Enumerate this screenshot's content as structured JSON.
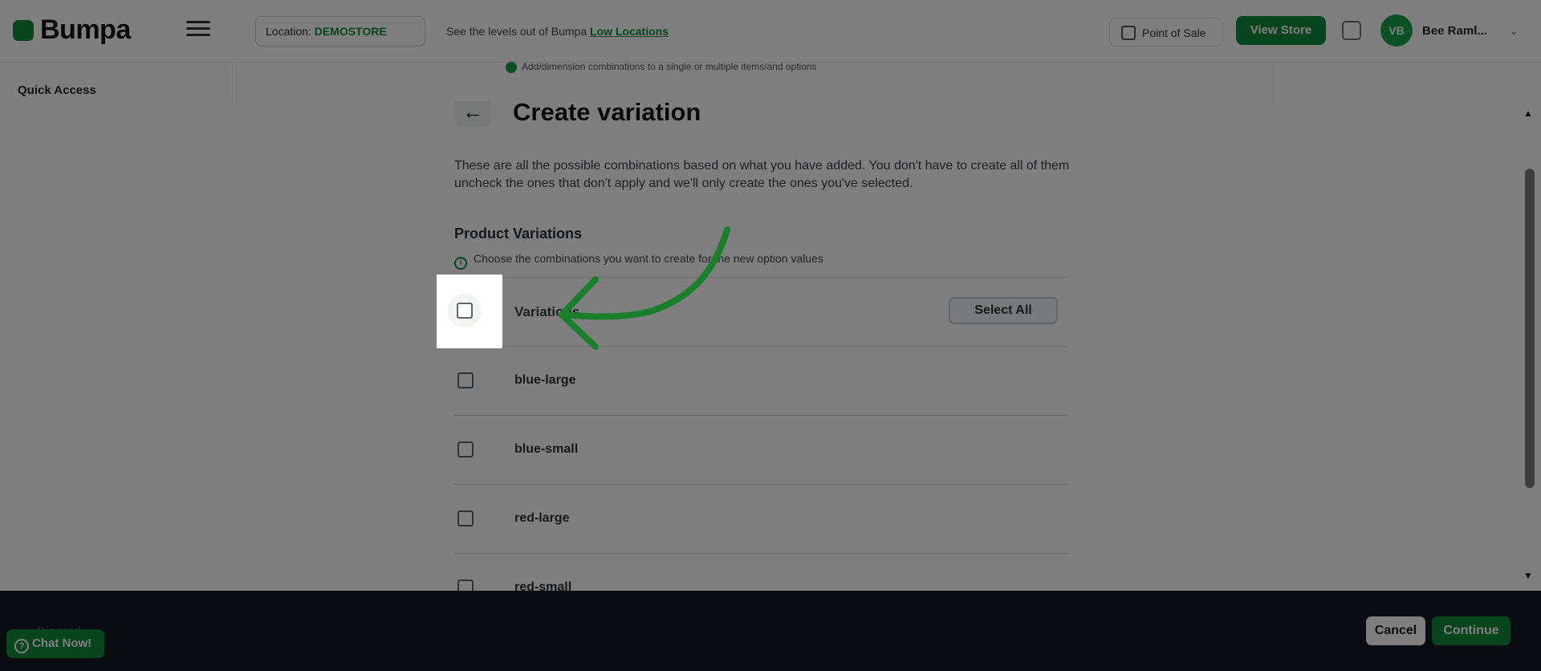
{
  "topbar": {
    "logo_text": "Bumpa",
    "location_label": "Location:",
    "location_value": "DEMOSTORE",
    "stock_text": "See the levels out of Bumpa",
    "stock_link": "Low Locations",
    "point_of_sale": "Point of Sale",
    "view_store": "View Store",
    "avatar_initials": "VB",
    "user_name": "Bee Raml..."
  },
  "sidebar": {
    "quick_access": "Quick Access"
  },
  "background_notice": "Add/dimension combinations to a single or multiple items/and options",
  "modal": {
    "title": "Create variation",
    "description": "These are all the possible combinations based on what you have added. You don't have to create all of them uncheck the ones that don't apply and we'll only create the ones you've selected.",
    "section_title": "Product Variations",
    "hint": "Choose the combinations you want to create for the new option values",
    "header_label": "Variations",
    "select_all": "Select All",
    "variations": [
      "blue-large",
      "blue-small",
      "red-large",
      "red-small"
    ]
  },
  "footer": {
    "ghost_text": "Discard",
    "chat": "Chat Now!",
    "cancel": "Cancel",
    "continue": "Continue"
  },
  "colors": {
    "brand_green": "#0f8a3c",
    "footer_bg": "#121a1f",
    "arrow_green": "#1a7f2a"
  }
}
